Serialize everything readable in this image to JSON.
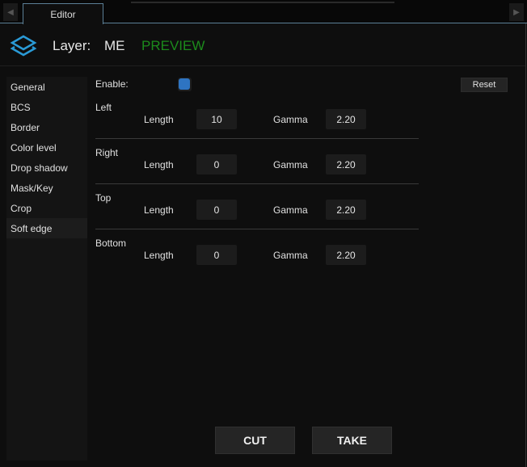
{
  "tabs": [
    {
      "label": "Editor"
    }
  ],
  "header": {
    "layer_label": "Layer:",
    "layer_value": "ME",
    "mode": "PREVIEW",
    "mode_color": "#1c8a1c",
    "accent": "#2a9ad6"
  },
  "sidebar": {
    "items": [
      {
        "label": "General"
      },
      {
        "label": "BCS"
      },
      {
        "label": "Border"
      },
      {
        "label": "Color level"
      },
      {
        "label": "Drop shadow"
      },
      {
        "label": "Mask/Key"
      },
      {
        "label": "Crop"
      },
      {
        "label": "Soft edge"
      }
    ],
    "selected": "Soft edge"
  },
  "form": {
    "enable_label": "Enable:",
    "enable_checked": true,
    "reset_label": "Reset",
    "sections": [
      {
        "title": "Left",
        "length_label": "Length",
        "length": "10",
        "gamma_label": "Gamma",
        "gamma": "2.20"
      },
      {
        "title": "Right",
        "length_label": "Length",
        "length": "0",
        "gamma_label": "Gamma",
        "gamma": "2.20"
      },
      {
        "title": "Top",
        "length_label": "Length",
        "length": "0",
        "gamma_label": "Gamma",
        "gamma": "2.20"
      },
      {
        "title": "Bottom",
        "length_label": "Length",
        "length": "0",
        "gamma_label": "Gamma",
        "gamma": "2.20"
      }
    ]
  },
  "actions": {
    "cut": "CUT",
    "take": "TAKE"
  }
}
